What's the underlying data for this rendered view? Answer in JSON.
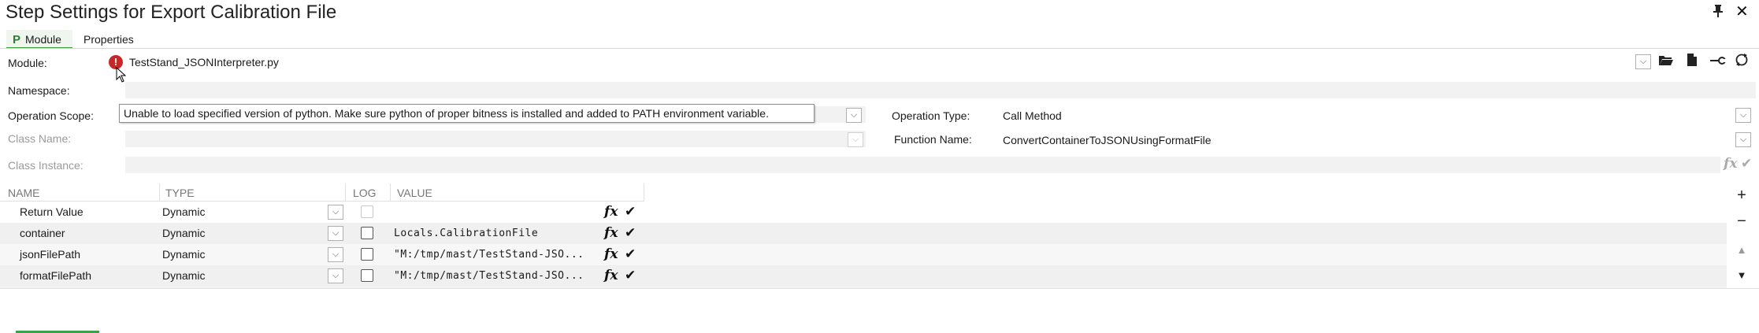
{
  "window": {
    "title": "Step Settings for Export Calibration File"
  },
  "tabs": [
    {
      "label": "Module",
      "glyph": "P"
    },
    {
      "label": "Properties"
    }
  ],
  "form": {
    "module_label": "Module:",
    "module_value": "TestStand_JSONInterpreter.py",
    "namespace_label": "Namespace:",
    "namespace_value": "",
    "operation_scope_label": "Operation Scope:",
    "operation_type_label": "Operation Type:",
    "operation_type_value": "Call Method",
    "class_name_label": "Class Name:",
    "function_name_label": "Function Name:",
    "function_name_value": "ConvertContainerToJSONUsingFormatFile",
    "class_instance_label": "Class Instance:"
  },
  "tooltip": "Unable to load specified version of python. Make sure python of proper bitness is installed and added to PATH environment variable.",
  "grid": {
    "headers": [
      "NAME",
      "TYPE",
      "LOG",
      "VALUE"
    ],
    "rows": [
      {
        "name": "Return Value",
        "type": "Dynamic",
        "log": false,
        "log_disabled": true,
        "value": ""
      },
      {
        "name": "container",
        "type": "Dynamic",
        "log": false,
        "log_disabled": false,
        "value": "Locals.CalibrationFile"
      },
      {
        "name": "jsonFilePath",
        "type": "Dynamic",
        "log": false,
        "log_disabled": false,
        "value": "\"M:/tmp/mast/TestStand-JSO..."
      },
      {
        "name": "formatFilePath",
        "type": "Dynamic",
        "log": false,
        "log_disabled": false,
        "value": "\"M:/tmp/mast/TestStand-JSO..."
      }
    ]
  },
  "glyphs": {
    "fx": "fx",
    "check": "✔",
    "pin": "🖈",
    "close": "✕"
  },
  "icons": [
    "error-icon",
    "folder-open-icon",
    "edit-file-icon",
    "wrench-icon",
    "refresh-icon",
    "pin-icon",
    "close-icon",
    "plus-icon",
    "minus-icon",
    "move-up-icon",
    "move-down-icon"
  ],
  "colors": {
    "error": "#c62828",
    "accent_green": "#3a9a3a"
  }
}
